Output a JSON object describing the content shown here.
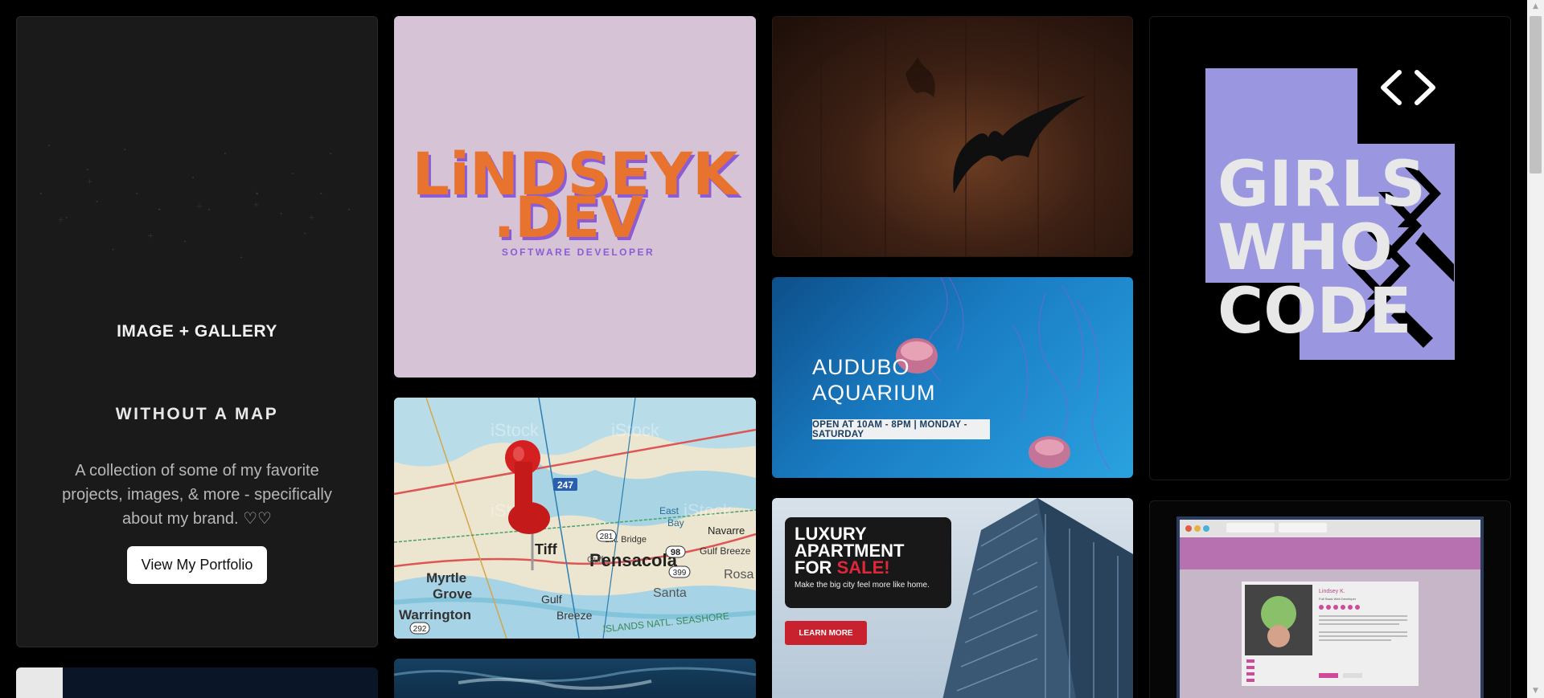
{
  "intro": {
    "logo": "IMAGE + GALLERY",
    "title": "WITHOUT A MAP",
    "description": "A collection of some of my favorite projects, images, & more - specifically about my brand. ♡♡",
    "button_label": "View My Portfolio"
  },
  "cards": {
    "lindsey": {
      "line1": "LiNDSEYK",
      "line2": ".DEV",
      "subtitle": "SOFTWARE DEVELOPER"
    },
    "map": {
      "watermark": "iStock",
      "labels": [
        "Pensacola",
        "Myrtle",
        "Grove",
        "Warrington",
        "Gulf",
        "Breeze",
        "Santa",
        "Rosa",
        "East",
        "Bay",
        "Tiff",
        "Navarre",
        "Gulf Breeze",
        "Lilt. Bridge",
        "Gulf",
        "ISLANDS NATL. SEASHORE"
      ],
      "route_numbers": [
        "247",
        "98",
        "281",
        "399",
        "98",
        "292"
      ]
    },
    "aquarium": {
      "title_line1": "AUDUBO",
      "title_line2": "AQUARIUM",
      "hours": "OPEN AT 10AM - 8PM | MONDAY -SATURDAY"
    },
    "luxury": {
      "line1": "LUXURY",
      "line2": "APARTMENT",
      "line3_a": "FOR ",
      "line3_b": "SALE!",
      "subtitle": "Make the big city feel more like home.",
      "button": "LEARN MORE"
    },
    "gwc": {
      "line1": "GIRLS",
      "line2": "WHO",
      "line3": "CODE"
    },
    "screenshot": {
      "name": "Lindsey K.",
      "role": "Full Stack Web Developer"
    }
  },
  "colors": {
    "page_bg": "#000000",
    "intro_bg": "#1a1a1a",
    "lindsey_bg": "#d6c4d6",
    "lindsey_orange": "#e8732e",
    "lindsey_purple": "#8b5cd6",
    "gwc_purple": "#9a96e0",
    "sale_red": "#e0273a"
  }
}
